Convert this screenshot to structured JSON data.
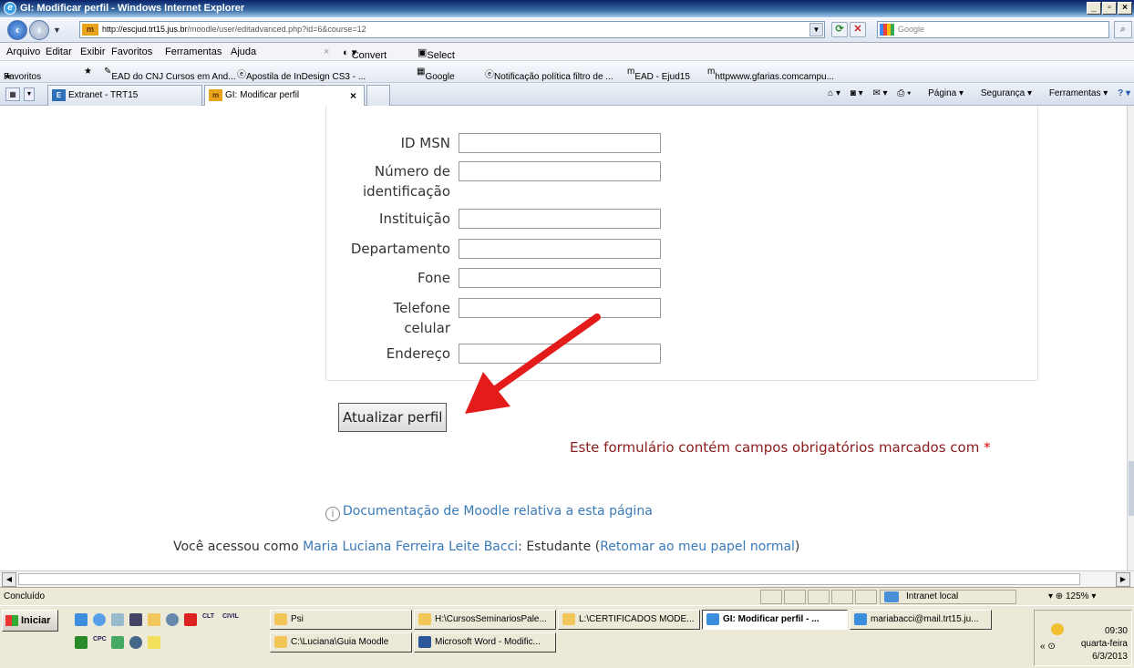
{
  "window": {
    "title": "GI: Modificar perfil - Windows Internet Explorer"
  },
  "address": {
    "url_host": "http://escjud.trt15.jus.br",
    "url_path": "/moodle/user/editadvanced.php?id=6&course=12",
    "search_placeholder": "Google"
  },
  "menu": [
    "Arquivo",
    "Editar",
    "Exibir",
    "Favoritos",
    "Ferramentas",
    "Ajuda"
  ],
  "toolbar_extras": {
    "convert": "Convert",
    "select": "Select"
  },
  "favorites": {
    "label": "Favoritos",
    "items": [
      "EAD do CNJ Cursos em And...",
      "Apostila de InDesign CS3 - ...",
      "Google",
      "Notificação política filtro de ...",
      "EAD - Ejud15",
      "httpwww.gfarias.comcampu..."
    ]
  },
  "tabs": [
    {
      "label": "Extranet - TRT15",
      "active": false
    },
    {
      "label": "GI: Modificar perfil",
      "active": true
    }
  ],
  "commands": [
    "Página",
    "Segurança",
    "Ferramentas"
  ],
  "form": {
    "fields": [
      {
        "label": "ID MSN",
        "value": ""
      },
      {
        "label": "Número de identificação",
        "value": ""
      },
      {
        "label": "Instituição",
        "value": ""
      },
      {
        "label": "Departamento",
        "value": ""
      },
      {
        "label": "Fone",
        "value": ""
      },
      {
        "label": "Telefone celular",
        "value": ""
      },
      {
        "label": "Endereço",
        "value": ""
      }
    ],
    "labels": {
      "msn": "ID MSN",
      "idnum_1": "Número de",
      "idnum_2": "identificação",
      "institution": "Instituição",
      "department": "Departamento",
      "phone": "Fone",
      "cell_1": "Telefone",
      "cell_2": "celular",
      "address": "Endereço"
    },
    "submit_label": "Atualizar perfil",
    "required_note": "Este formulário contém campos obrigatórios marcados com",
    "required_mark": "*"
  },
  "footer": {
    "doc_link": "Documentação de Moodle relativa a esta página",
    "login_prefix": "Você acessou como",
    "user_name": "Maria Luciana Ferreira Leite Bacci",
    "role_text": ": Estudante (",
    "return_link": "Retomar ao meu papel normal",
    "close_paren": ")"
  },
  "status": {
    "text": "Concluído",
    "zone": "Intranet local",
    "zoom": "125%"
  },
  "taskbar": {
    "start": "Iniciar",
    "quicklaunch_labels": [
      "CLT",
      "CIVIL",
      "CPC"
    ],
    "buttons_row1": [
      {
        "label": "Psi",
        "icon": "folder-icon",
        "active": false
      },
      {
        "label": "H:\\CursosSeminariosPale...",
        "icon": "folder-icon",
        "active": false
      },
      {
        "label": "L:\\CERTIFICADOS MODE...",
        "icon": "folder-icon",
        "active": false
      },
      {
        "label": "GI: Modificar perfil - ...",
        "icon": "iefile-icon",
        "active": true
      },
      {
        "label": "mariabacci@mail.trt15.ju...",
        "icon": "iefile-icon",
        "active": false
      }
    ],
    "buttons_row2": [
      {
        "label": "C:\\Luciana\\Guia Moodle",
        "icon": "folder-icon",
        "active": false
      },
      {
        "label": "Microsoft Word - Modific...",
        "icon": "word-icon",
        "active": false
      }
    ],
    "clock": {
      "time": "09:30",
      "day": "quarta-feira",
      "date": "6/3/2013"
    }
  },
  "colors": {
    "link": "#3a7ab8",
    "required": "#8b1c1c",
    "arrow": "#e31b1b"
  }
}
